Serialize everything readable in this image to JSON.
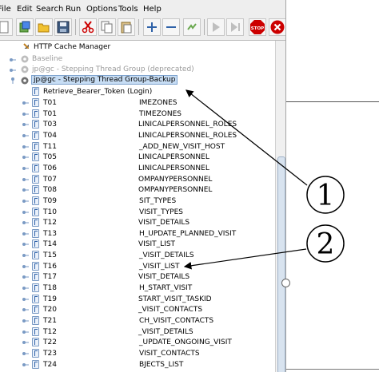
{
  "menu": [
    "File",
    "Edit",
    "Search",
    "Run",
    "Options",
    "Tools",
    "Help"
  ],
  "toolbar": {
    "icons": [
      "new-icon",
      "templates-icon",
      "open-icon",
      "save-icon",
      "cut-icon",
      "copy-icon",
      "paste-icon",
      "expand-icon",
      "collapse-icon",
      "toggle-icon",
      "start-icon",
      "start-no-pause-icon",
      "stop-icon",
      "shutdown-icon"
    ],
    "stop_label": "STOP"
  },
  "tree": {
    "nodes": [
      {
        "label": "HTTP Cache Manager",
        "kind": "cache",
        "disabled": false
      },
      {
        "label": "Baseline",
        "kind": "gear",
        "disabled": true
      },
      {
        "label": "jp@gc - Stepping Thread Group (deprecated)",
        "kind": "gear",
        "disabled": true
      },
      {
        "label": "jp@gc - Stepping Thread Group-Backup",
        "kind": "gear",
        "disabled": false,
        "selected": true
      },
      {
        "label": "Retrieve_Bearer_Token (Login)",
        "kind": "sampler"
      },
      {
        "label": "T01",
        "suffix": "IMEZONES"
      },
      {
        "label": "T01",
        "suffix": "TIMEZONES"
      },
      {
        "label": "T03",
        "suffix": "LINICALPERSONNEL_ROLES"
      },
      {
        "label": "T04",
        "suffix": "LINICALPERSONNEL_ROLES"
      },
      {
        "label": "T11",
        "suffix": "_ADD_NEW_VISIT_HOST"
      },
      {
        "label": "T05",
        "suffix": "LINICALPERSONNEL"
      },
      {
        "label": "T06",
        "suffix": "LINICALPERSONNEL"
      },
      {
        "label": "T07",
        "suffix": "OMPANYPERSONNEL"
      },
      {
        "label": "T08",
        "suffix": "OMPANYPERSONNEL"
      },
      {
        "label": "T09",
        "suffix": "SIT_TYPES"
      },
      {
        "label": "T10",
        "suffix": "VISIT_TYPES"
      },
      {
        "label": "T12",
        "suffix": "VISIT_DETAILS"
      },
      {
        "label": "T13",
        "suffix": "H_UPDATE_PLANNED_VISIT"
      },
      {
        "label": "T14",
        "suffix": "VISIT_LIST"
      },
      {
        "label": "T15",
        "suffix": "_VISIT_DETAILS"
      },
      {
        "label": "T16",
        "suffix": "_VISIT_LIST"
      },
      {
        "label": "T17",
        "suffix": "VISIT_DETAILS"
      },
      {
        "label": "T18",
        "suffix": "H_START_VISIT"
      },
      {
        "label": "T19",
        "suffix": "START_VISIT_TASKID"
      },
      {
        "label": "T20",
        "suffix": "_VISIT_CONTACTS"
      },
      {
        "label": "T21",
        "suffix": "CH_VISIT_CONTACTS"
      },
      {
        "label": "T12",
        "suffix": "_VISIT_DETAILS"
      },
      {
        "label": "T22",
        "suffix": "_UPDATE_ONGOING_VISIT"
      },
      {
        "label": "T23",
        "suffix": "VISIT_CONTACTS"
      },
      {
        "label": "T24",
        "suffix": "BJECTS_LIST"
      }
    ]
  },
  "callouts": [
    "1",
    "2"
  ]
}
